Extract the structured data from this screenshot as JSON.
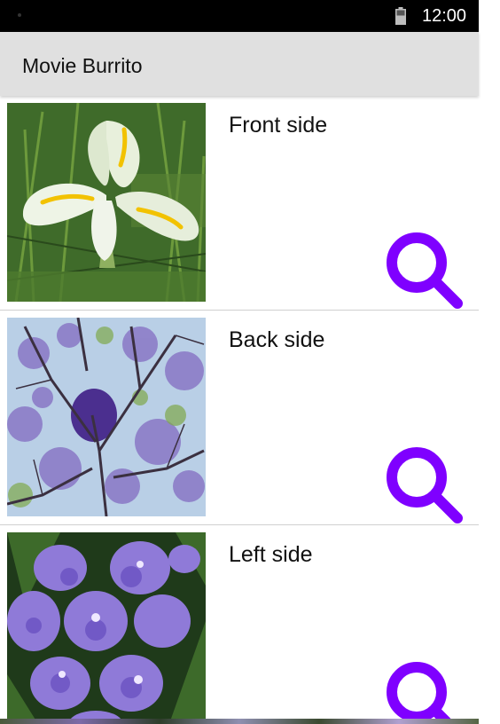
{
  "status_bar": {
    "time": "12:00",
    "battery_icon": "battery-icon"
  },
  "app_bar": {
    "title": "Movie Burrito"
  },
  "items": [
    {
      "label": "Front side",
      "image": "white-iris-flower-photo",
      "action_icon": "search-icon"
    },
    {
      "label": "Back side",
      "image": "jacaranda-tree-blossoms-photo",
      "action_icon": "search-icon"
    },
    {
      "label": "Left side",
      "image": "purple-orchid-flowers-photo",
      "action_icon": "search-icon"
    }
  ],
  "colors": {
    "search_icon": "#7f00ff",
    "app_bar_bg": "#e0e0e0",
    "status_bar_bg": "#000000"
  }
}
